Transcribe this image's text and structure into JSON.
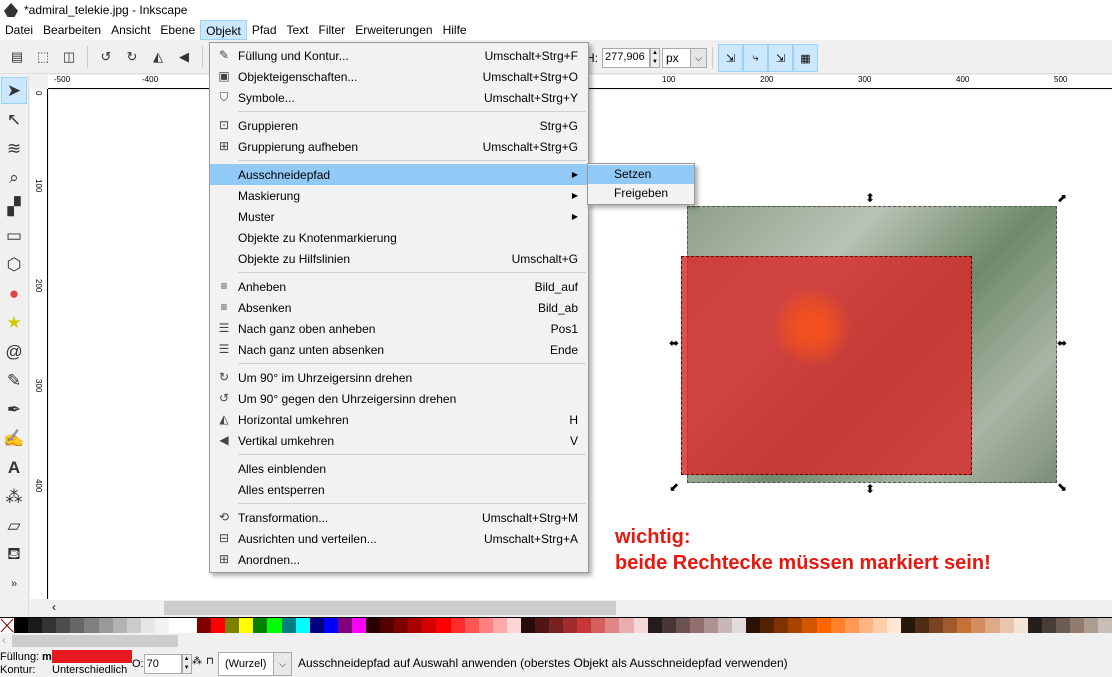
{
  "window": {
    "title": "*admiral_telekie.jpg - Inkscape"
  },
  "menubar": [
    "Datei",
    "Bearbeiten",
    "Ansicht",
    "Ebene",
    "Objekt",
    "Pfad",
    "Text",
    "Filter",
    "Erweiterungen",
    "Hilfe"
  ],
  "toolbar": {
    "h_label": "H:",
    "h_value": "277,906",
    "unit": "px"
  },
  "ruler": {
    "h": [
      "-500",
      "-400",
      "100",
      "200",
      "300",
      "400",
      "500"
    ],
    "v": [
      "0",
      "100",
      "200",
      "300",
      "400"
    ]
  },
  "objekt_menu": [
    {
      "icon": "fill-stroke-icon",
      "label": "Füllung und Kontur...",
      "shortcut": "Umschalt+Strg+F"
    },
    {
      "icon": "object-properties-icon",
      "label": "Objekteigenschaften...",
      "shortcut": "Umschalt+Strg+O"
    },
    {
      "icon": "symbols-icon",
      "label": "Symbole...",
      "shortcut": "Umschalt+Strg+Y"
    },
    {
      "sep": true
    },
    {
      "icon": "group-icon",
      "label": "Gruppieren",
      "shortcut": "Strg+G"
    },
    {
      "icon": "ungroup-icon",
      "label": "Gruppierung aufheben",
      "shortcut": "Umschalt+Strg+G"
    },
    {
      "sep": true
    },
    {
      "icon": "",
      "label": "Ausschneidepfad",
      "shortcut": "",
      "submenu": true,
      "highlighted": true
    },
    {
      "icon": "",
      "label": "Maskierung",
      "shortcut": "",
      "submenu": true
    },
    {
      "icon": "",
      "label": "Muster",
      "shortcut": "",
      "submenu": true
    },
    {
      "icon": "",
      "label": "Objekte zu Knotenmarkierung",
      "shortcut": ""
    },
    {
      "icon": "",
      "label": "Objekte zu Hilfslinien",
      "shortcut": "Umschalt+G"
    },
    {
      "sep": true
    },
    {
      "icon": "raise-icon",
      "label": "Anheben",
      "shortcut": "Bild_auf"
    },
    {
      "icon": "lower-icon",
      "label": "Absenken",
      "shortcut": "Bild_ab"
    },
    {
      "icon": "raise-top-icon",
      "label": "Nach ganz oben anheben",
      "shortcut": "Pos1"
    },
    {
      "icon": "lower-bottom-icon",
      "label": "Nach ganz unten absenken",
      "shortcut": "Ende"
    },
    {
      "sep": true
    },
    {
      "icon": "rotate-cw-icon",
      "label": "Um 90° im Uhrzeigersinn drehen",
      "shortcut": ""
    },
    {
      "icon": "rotate-ccw-icon",
      "label": "Um 90° gegen den Uhrzeigersinn drehen",
      "shortcut": ""
    },
    {
      "icon": "flip-horizontal-icon",
      "label": "Horizontal umkehren",
      "shortcut": "H"
    },
    {
      "icon": "flip-vertical-icon",
      "label": "Vertikal umkehren",
      "shortcut": "V"
    },
    {
      "sep": true
    },
    {
      "icon": "",
      "label": "Alles einblenden",
      "shortcut": ""
    },
    {
      "icon": "",
      "label": "Alles entsperren",
      "shortcut": ""
    },
    {
      "sep": true
    },
    {
      "icon": "transform-icon",
      "label": "Transformation...",
      "shortcut": "Umschalt+Strg+M"
    },
    {
      "icon": "align-icon",
      "label": "Ausrichten und verteilen...",
      "shortcut": "Umschalt+Strg+A"
    },
    {
      "icon": "arrange-icon",
      "label": "Anordnen...",
      "shortcut": ""
    }
  ],
  "submenu": [
    "Setzen",
    "Freigeben"
  ],
  "note": {
    "line1": "wichtig:",
    "line2": "beide Rechtecke müssen markiert sein!",
    "color": "#e5190f"
  },
  "palette": [
    "#000000",
    "#1a1a1a",
    "#333333",
    "#4d4d4d",
    "#666666",
    "#808080",
    "#999999",
    "#b3b3b3",
    "#cccccc",
    "#e6e6e6",
    "#f2f2f2",
    "#ffffff",
    "#ffffff",
    "#800000",
    "#ff0000",
    "#808000",
    "#ffff00",
    "#008000",
    "#00ff00",
    "#008080",
    "#00ffff",
    "#000080",
    "#0000ff",
    "#800080",
    "#ff00ff",
    "#2b0000",
    "#550000",
    "#800000",
    "#aa0000",
    "#d40000",
    "#ff0000",
    "#ff2a2a",
    "#ff5555",
    "#ff8080",
    "#ffaaaa",
    "#ffd5d5",
    "#280b0b",
    "#501616",
    "#782121",
    "#a02c2c",
    "#c83737",
    "#d35f5f",
    "#de8787",
    "#e9afaf",
    "#f4d7d7",
    "#241c1c",
    "#483737",
    "#6c5353",
    "#916f6f",
    "#ac9393",
    "#c8b7b7",
    "#e3dbdb",
    "#2b1100",
    "#552200",
    "#803300",
    "#aa4400",
    "#d45500",
    "#ff6600",
    "#ff7f2a",
    "#ff9955",
    "#ffb380",
    "#ffccaa",
    "#ffe6d5",
    "#28170b",
    "#502d16",
    "#784421",
    "#a05a2c",
    "#c87137",
    "#d38d5f",
    "#deaa87",
    "#e9c6af",
    "#f4e3d7",
    "#241f1c",
    "#483e37",
    "#6c5d53",
    "#917c6f",
    "#ac9d93",
    "#c8beb7"
  ],
  "status": {
    "fill_label": "Füllung:",
    "fill_value": "m",
    "fill_color": "#e5191f",
    "stroke_label": "Kontur:",
    "stroke_value": "Unterschiedlich",
    "opacity_label": "O:",
    "opacity_value": "70",
    "layer": "(Wurzel)",
    "message": "Ausschneidepfad auf Auswahl anwenden (oberstes Objekt als Ausschneidepfad verwenden)"
  }
}
